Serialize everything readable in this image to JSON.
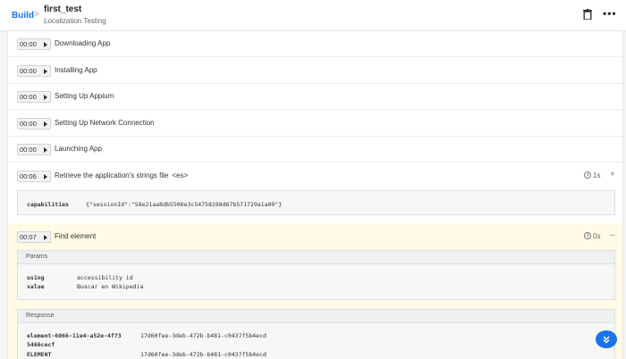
{
  "header": {
    "breadcrumb_build": "Build",
    "breadcrumb_sep": ">",
    "title": "first_test",
    "subtitle": "Localization Testing",
    "more_label": "•••"
  },
  "steps": [
    {
      "time": "00:00",
      "label": "Downloading App"
    },
    {
      "time": "00:00",
      "label": "Installing App"
    },
    {
      "time": "00:00",
      "label": "Setting Up Appium"
    },
    {
      "time": "00:00",
      "label": "Setting Up Network Connection"
    },
    {
      "time": "00:00",
      "label": "Launching App"
    },
    {
      "time": "00:06",
      "label": "Retrieve the application's strings file",
      "tag": "<es>",
      "duration": "1s",
      "toggle": "+"
    },
    {
      "time": "00:07",
      "label": "Find element",
      "duration": "0s",
      "toggle": "–"
    }
  ],
  "capabilities": {
    "key": "capabilities",
    "value": "{\"sessionId\":\"58e21aa8db5506e3c54758198d67b571729a1a09\"}"
  },
  "params": {
    "title": "Params",
    "rows": [
      {
        "key": "using",
        "value": "accessibility id"
      },
      {
        "key": "value",
        "value": "Buscar en Wikipedia"
      }
    ]
  },
  "response": {
    "title": "Response",
    "rows": [
      {
        "key": "element-6066-11e4-a52e-4f73",
        "key2": "5466cecf",
        "value": "17d60fee-3deb-472b-b481-c0437f5b4ecd"
      },
      {
        "key": "ELEMENT",
        "value": "17d60fee-3deb-472b-b481-c0437f5b4ecd"
      }
    ]
  },
  "colors": {
    "accent": "#1a73e8",
    "active_bg": "#fffbe6"
  }
}
